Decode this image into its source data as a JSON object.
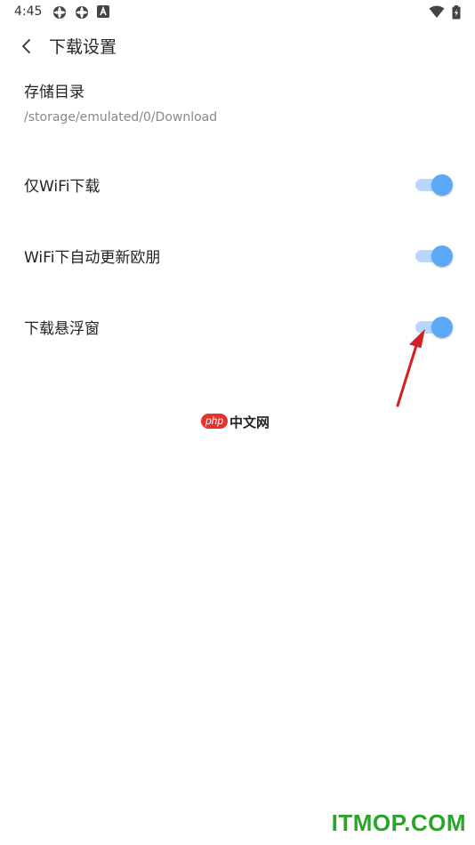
{
  "status_bar": {
    "time": "4:45",
    "icons": [
      "sync-icon",
      "sync-icon",
      "a-badge-icon",
      "wifi-icon",
      "battery-icon"
    ]
  },
  "header": {
    "title": "下载设置",
    "back_icon": "chevron-left-icon"
  },
  "storage": {
    "label": "存储目录",
    "path": "/storage/emulated/0/Download"
  },
  "settings": [
    {
      "label": "仅WiFi下载",
      "enabled": true
    },
    {
      "label": "WiFi下自动更新欧朋",
      "enabled": true
    },
    {
      "label": "下载悬浮窗",
      "enabled": true
    }
  ],
  "colors": {
    "toggle_thumb": "#5ba8f7",
    "toggle_track": "#b7d8fb",
    "annotation_arrow": "#d42020",
    "watermark": "#2aa52a",
    "php_badge": "#e8302c"
  },
  "logo": {
    "badge": "php",
    "text": "中文网"
  },
  "watermark": "ITMOP.COM"
}
